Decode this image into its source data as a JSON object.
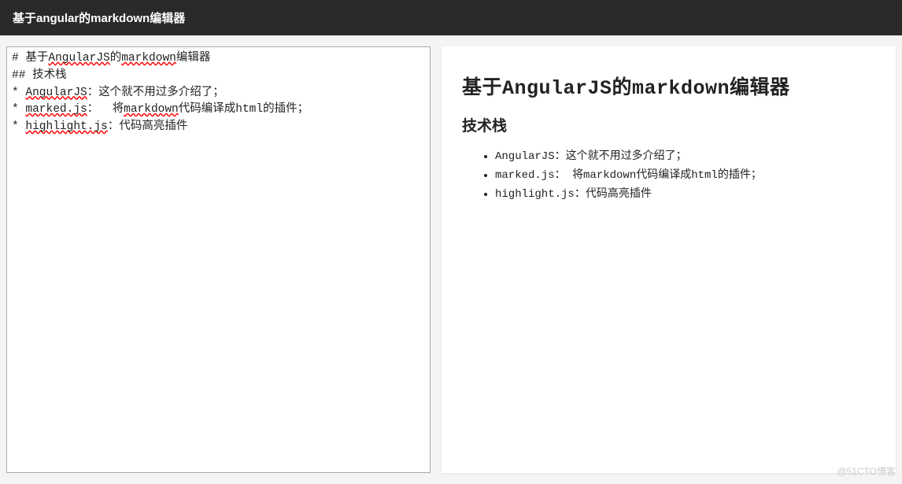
{
  "header": {
    "title": "基于angular的markdown编辑器"
  },
  "editor": {
    "lines": [
      {
        "segments": [
          {
            "t": "# 基于"
          },
          {
            "t": "AngularJS",
            "spell": true
          },
          {
            "t": "的"
          },
          {
            "t": "markdown",
            "spell": true
          },
          {
            "t": "编辑器"
          }
        ]
      },
      {
        "segments": [
          {
            "t": "## 技术栈"
          }
        ]
      },
      {
        "segments": [
          {
            "t": "* "
          },
          {
            "t": "AngularJS",
            "spell": true
          },
          {
            "t": "：这个就不用过多介绍了；"
          }
        ]
      },
      {
        "segments": [
          {
            "t": "* "
          },
          {
            "t": "marked.js",
            "spell": true
          },
          {
            "t": "：  将"
          },
          {
            "t": "markdown",
            "spell": true
          },
          {
            "t": "代码编译成html的插件；"
          }
        ]
      },
      {
        "segments": [
          {
            "t": "* "
          },
          {
            "t": "highlight.js",
            "spell": true
          },
          {
            "t": "：代码高亮插件"
          }
        ]
      }
    ]
  },
  "preview": {
    "h1": "基于AngularJS的markdown编辑器",
    "h2": "技术栈",
    "items": [
      "AngularJS：这个就不用过多介绍了；",
      "marked.js：  将markdown代码编译成html的插件；",
      "highlight.js：代码高亮插件"
    ]
  },
  "watermark": "@51CTO博客"
}
